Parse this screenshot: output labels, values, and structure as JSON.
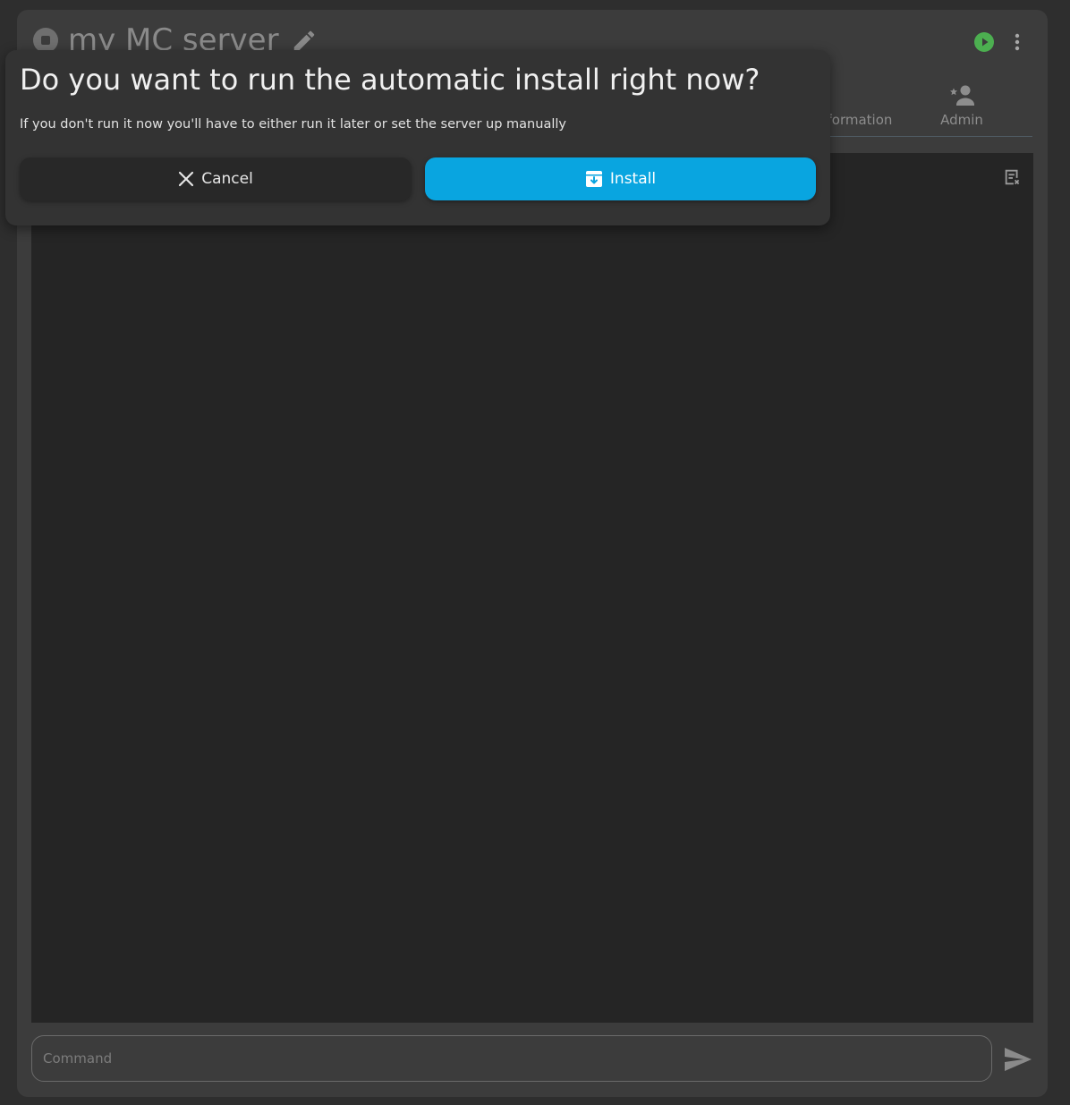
{
  "header": {
    "server_name": "my MC server"
  },
  "tabs": {
    "information_label": "Information",
    "admin_label": "Admin"
  },
  "console": {
    "command_placeholder": "Command"
  },
  "dialog": {
    "title": "Do you want to run the automatic install right now?",
    "text": "If you don't run it now you'll have to either run it later or set the server up manually",
    "cancel_label": "Cancel",
    "install_label": "Install"
  },
  "colors": {
    "accent": "#09a5e0",
    "running_green": "#4caf50",
    "background": "#2e2e2e",
    "card": "#3c3c3c",
    "console": "#252525"
  },
  "icons": {
    "status": "stop-circle-icon",
    "edit": "pencil-icon",
    "start": "play-circle-icon",
    "more": "dots-vertical-icon",
    "admin": "account-star-icon",
    "clear": "note-remove-icon",
    "send": "send-icon",
    "cancel": "close-icon",
    "install": "archive-arrow-down-icon"
  }
}
